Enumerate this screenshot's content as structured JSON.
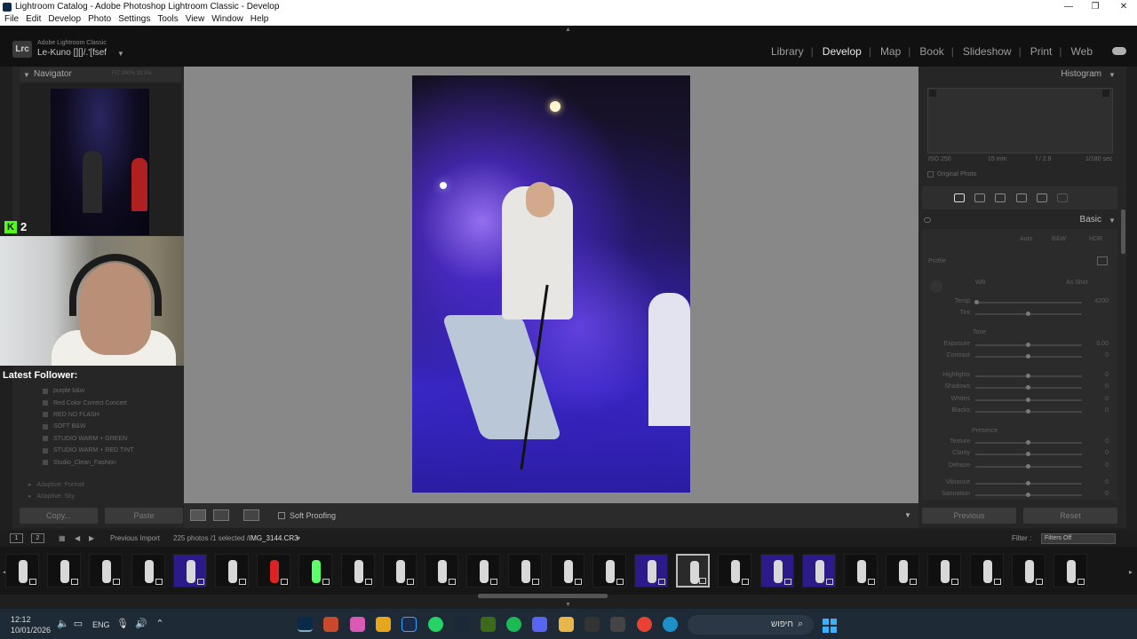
{
  "window": {
    "title": "Lightroom Catalog - Adobe Photoshop Lightroom Classic - Develop"
  },
  "menu": [
    "File",
    "Edit",
    "Develop",
    "Photo",
    "Settings",
    "Tools",
    "View",
    "Window",
    "Help"
  ],
  "identity": {
    "badge": "Lrc",
    "product": "Adobe Lightroom Classic",
    "catalog": "Le-Kuno [][]/.'[fsef"
  },
  "modules": [
    "Library",
    "Develop",
    "Map",
    "Book",
    "Slideshow",
    "Print",
    "Web"
  ],
  "active_module": "Develop",
  "navigator": {
    "title": "Navigator",
    "zoom": "FIT   100%   33.3%"
  },
  "overlay": {
    "kick_count": "2",
    "kick_letter": "K",
    "latest_follower_label": "Latest Follower:"
  },
  "presets": [
    "purple b&w",
    "Red Color Correct Concert",
    "RED NO FLASH",
    "SOFT B&W",
    "STUDIO WARM + GREEN",
    "STUDIO WARM + RED TINT",
    "Studio_Clean_Fashion"
  ],
  "preset_groups": [
    "Adaptive: Portrait",
    "Adaptive: Sky"
  ],
  "left_buttons": {
    "copy": "Copy...",
    "paste": "Paste"
  },
  "toolbar": {
    "soft_proofing": "Soft Proofing"
  },
  "histogram": {
    "title": "Histogram",
    "iso": "ISO 250",
    "focal": "15 mm",
    "aperture": "f / 2.8",
    "shutter": "1/180 sec",
    "original_photo": "Original Photo"
  },
  "basic": {
    "title": "Basic",
    "auto": "Auto",
    "bw": "B&W",
    "hdr": "HDR",
    "profile_label": "Profile",
    "wb_label": "WB",
    "wb_value": "As Shot",
    "tone_label": "Tone",
    "presence_label": "Presence",
    "sliders": [
      {
        "label": "Temp",
        "value": "4200"
      },
      {
        "label": "Tint",
        "value": ""
      },
      {
        "label": "Exposure",
        "value": "0.00"
      },
      {
        "label": "Contrast",
        "value": "0"
      },
      {
        "label": "Highlights",
        "value": "0"
      },
      {
        "label": "Shadows",
        "value": "0"
      },
      {
        "label": "Whites",
        "value": "0"
      },
      {
        "label": "Blacks",
        "value": "0"
      },
      {
        "label": "Texture",
        "value": "0"
      },
      {
        "label": "Clarity",
        "value": "0"
      },
      {
        "label": "Dehaze",
        "value": "0"
      },
      {
        "label": "Vibrance",
        "value": "0"
      },
      {
        "label": "Saturation",
        "value": "0"
      }
    ]
  },
  "right_buttons": {
    "previous": "Previous",
    "reset": "Reset"
  },
  "filmbar": {
    "screen1": "1",
    "screen2": "2",
    "source": "Previous Import",
    "count": "225 photos /1 selected /",
    "filename": "IMG_3144.CR3",
    "filter_label": "Filter :",
    "filter_value": "Filters Off"
  },
  "taskbar": {
    "time": "12:12",
    "date": "10/01/2026",
    "lang": "ENG",
    "search": "חיפוש"
  },
  "colors": {
    "accent": "#53fc18",
    "panel": "#262626",
    "center": "#888888"
  }
}
